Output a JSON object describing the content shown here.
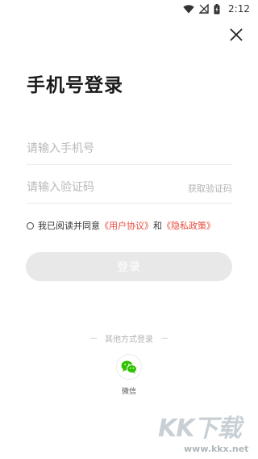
{
  "status_bar": {
    "time": "2:12",
    "icons": [
      "wifi-icon",
      "signal-off-icon",
      "battery-charging-icon"
    ]
  },
  "header": {
    "close_icon": "close-icon"
  },
  "title": "手机号登录",
  "form": {
    "phone_placeholder": "请输入手机号",
    "code_placeholder": "请输入验证码",
    "get_code_label": "获取验证码"
  },
  "agreement": {
    "prefix": "我已阅读并同意",
    "user_agreement": "《用户协议》",
    "connector": "和",
    "privacy_policy": "《隐私政策》"
  },
  "login_button": "登录",
  "other_login": {
    "label": "其他方式登录",
    "wechat_label": "微信",
    "wechat_color": "#2dc100"
  },
  "watermark": {
    "logo": "KK下载",
    "url": "www.kkx.net"
  },
  "colors": {
    "link": "#e84b3c",
    "button_disabled": "#e8e8e8"
  }
}
